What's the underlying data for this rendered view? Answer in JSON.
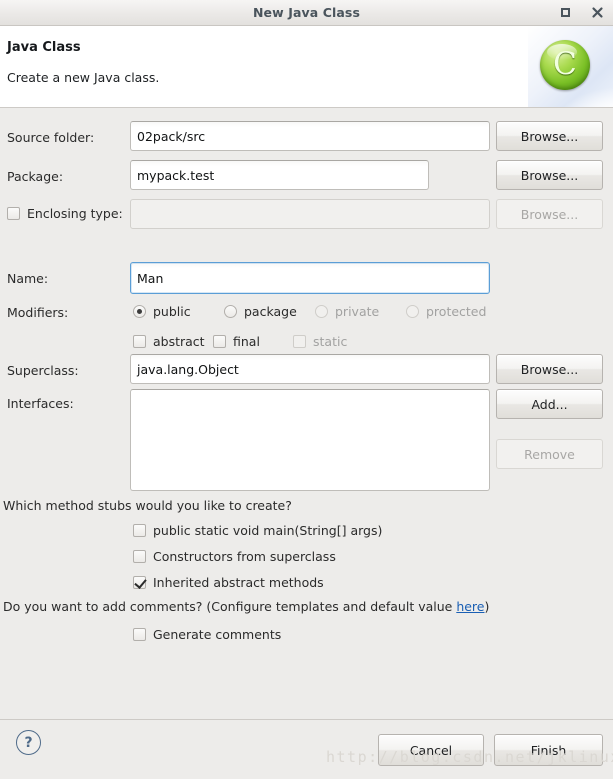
{
  "window": {
    "title": "New Java Class",
    "maximize_label": "maximize",
    "close_label": "close"
  },
  "header": {
    "title": "Java Class",
    "description": "Create a new Java class.",
    "badge_glyph": "C"
  },
  "form": {
    "source_folder": {
      "label": "Source folder:",
      "value": "02pack/src",
      "button": "Browse..."
    },
    "package": {
      "label": "Package:",
      "value": "mypack.test",
      "button": "Browse..."
    },
    "enclosing_type": {
      "label": "Enclosing type:",
      "value": "",
      "button": "Browse...",
      "checked": false,
      "enabled": false
    },
    "name": {
      "label": "Name:",
      "value": "Man"
    },
    "modifiers": {
      "label": "Modifiers:",
      "radios": [
        {
          "label": "public",
          "selected": true,
          "enabled": true
        },
        {
          "label": "package",
          "selected": false,
          "enabled": true
        },
        {
          "label": "private",
          "selected": false,
          "enabled": false
        },
        {
          "label": "protected",
          "selected": false,
          "enabled": false
        }
      ],
      "checkboxes": [
        {
          "label": "abstract",
          "checked": false,
          "enabled": true
        },
        {
          "label": "final",
          "checked": false,
          "enabled": true
        },
        {
          "label": "static",
          "checked": false,
          "enabled": false
        }
      ]
    },
    "superclass": {
      "label": "Superclass:",
      "value": "java.lang.Object",
      "button": "Browse..."
    },
    "interfaces": {
      "label": "Interfaces:",
      "items": [],
      "add_button": "Add...",
      "remove_button": "Remove"
    }
  },
  "stubs": {
    "question": "Which method stubs would you like to create?",
    "options": [
      {
        "label": "public static void main(String[] args)",
        "checked": false
      },
      {
        "label": "Constructors from superclass",
        "checked": false
      },
      {
        "label": "Inherited abstract methods",
        "checked": true
      }
    ]
  },
  "comments": {
    "question_prefix": "Do you want to add comments? (Configure templates and default value ",
    "link": "here",
    "question_suffix": ")",
    "option": {
      "label": "Generate comments",
      "checked": false
    }
  },
  "footer": {
    "help_glyph": "?",
    "cancel": "Cancel",
    "finish": "Finish"
  },
  "watermark": "http://blog.csdn.net/jklinux",
  "colors": {
    "dialog_bg": "#edecea",
    "accent_link": "#1a5fb4",
    "focus_border": "#5b9ed6",
    "badge_green": "#79bf25",
    "title_text": "#4a545c"
  }
}
